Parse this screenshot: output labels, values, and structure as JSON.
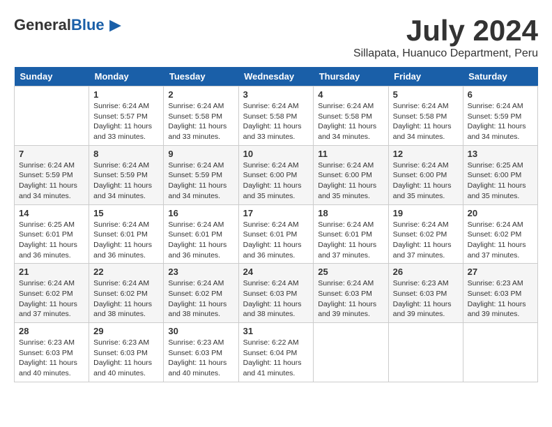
{
  "header": {
    "logo_general": "General",
    "logo_blue": "Blue",
    "month_year": "July 2024",
    "location": "Sillapata, Huanuco Department, Peru"
  },
  "days_of_week": [
    "Sunday",
    "Monday",
    "Tuesday",
    "Wednesday",
    "Thursday",
    "Friday",
    "Saturday"
  ],
  "weeks": [
    [
      {
        "day": "",
        "info": ""
      },
      {
        "day": "1",
        "info": "Sunrise: 6:24 AM\nSunset: 5:57 PM\nDaylight: 11 hours\nand 33 minutes."
      },
      {
        "day": "2",
        "info": "Sunrise: 6:24 AM\nSunset: 5:58 PM\nDaylight: 11 hours\nand 33 minutes."
      },
      {
        "day": "3",
        "info": "Sunrise: 6:24 AM\nSunset: 5:58 PM\nDaylight: 11 hours\nand 33 minutes."
      },
      {
        "day": "4",
        "info": "Sunrise: 6:24 AM\nSunset: 5:58 PM\nDaylight: 11 hours\nand 34 minutes."
      },
      {
        "day": "5",
        "info": "Sunrise: 6:24 AM\nSunset: 5:58 PM\nDaylight: 11 hours\nand 34 minutes."
      },
      {
        "day": "6",
        "info": "Sunrise: 6:24 AM\nSunset: 5:59 PM\nDaylight: 11 hours\nand 34 minutes."
      }
    ],
    [
      {
        "day": "7",
        "info": ""
      },
      {
        "day": "8",
        "info": "Sunrise: 6:24 AM\nSunset: 5:59 PM\nDaylight: 11 hours\nand 34 minutes."
      },
      {
        "day": "9",
        "info": "Sunrise: 6:24 AM\nSunset: 5:59 PM\nDaylight: 11 hours\nand 34 minutes."
      },
      {
        "day": "10",
        "info": "Sunrise: 6:24 AM\nSunset: 6:00 PM\nDaylight: 11 hours\nand 35 minutes."
      },
      {
        "day": "11",
        "info": "Sunrise: 6:24 AM\nSunset: 6:00 PM\nDaylight: 11 hours\nand 35 minutes."
      },
      {
        "day": "12",
        "info": "Sunrise: 6:24 AM\nSunset: 6:00 PM\nDaylight: 11 hours\nand 35 minutes."
      },
      {
        "day": "13",
        "info": "Sunrise: 6:25 AM\nSunset: 6:00 PM\nDaylight: 11 hours\nand 35 minutes."
      }
    ],
    [
      {
        "day": "14",
        "info": ""
      },
      {
        "day": "15",
        "info": "Sunrise: 6:24 AM\nSunset: 6:01 PM\nDaylight: 11 hours\nand 36 minutes."
      },
      {
        "day": "16",
        "info": "Sunrise: 6:24 AM\nSunset: 6:01 PM\nDaylight: 11 hours\nand 36 minutes."
      },
      {
        "day": "17",
        "info": "Sunrise: 6:24 AM\nSunset: 6:01 PM\nDaylight: 11 hours\nand 36 minutes."
      },
      {
        "day": "18",
        "info": "Sunrise: 6:24 AM\nSunset: 6:01 PM\nDaylight: 11 hours\nand 37 minutes."
      },
      {
        "day": "19",
        "info": "Sunrise: 6:24 AM\nSunset: 6:02 PM\nDaylight: 11 hours\nand 37 minutes."
      },
      {
        "day": "20",
        "info": "Sunrise: 6:24 AM\nSunset: 6:02 PM\nDaylight: 11 hours\nand 37 minutes."
      }
    ],
    [
      {
        "day": "21",
        "info": ""
      },
      {
        "day": "22",
        "info": "Sunrise: 6:24 AM\nSunset: 6:02 PM\nDaylight: 11 hours\nand 38 minutes."
      },
      {
        "day": "23",
        "info": "Sunrise: 6:24 AM\nSunset: 6:02 PM\nDaylight: 11 hours\nand 38 minutes."
      },
      {
        "day": "24",
        "info": "Sunrise: 6:24 AM\nSunset: 6:03 PM\nDaylight: 11 hours\nand 38 minutes."
      },
      {
        "day": "25",
        "info": "Sunrise: 6:24 AM\nSunset: 6:03 PM\nDaylight: 11 hours\nand 39 minutes."
      },
      {
        "day": "26",
        "info": "Sunrise: 6:23 AM\nSunset: 6:03 PM\nDaylight: 11 hours\nand 39 minutes."
      },
      {
        "day": "27",
        "info": "Sunrise: 6:23 AM\nSunset: 6:03 PM\nDaylight: 11 hours\nand 39 minutes."
      }
    ],
    [
      {
        "day": "28",
        "info": "Sunrise: 6:23 AM\nSunset: 6:03 PM\nDaylight: 11 hours\nand 40 minutes."
      },
      {
        "day": "29",
        "info": "Sunrise: 6:23 AM\nSunset: 6:03 PM\nDaylight: 11 hours\nand 40 minutes."
      },
      {
        "day": "30",
        "info": "Sunrise: 6:23 AM\nSunset: 6:03 PM\nDaylight: 11 hours\nand 40 minutes."
      },
      {
        "day": "31",
        "info": "Sunrise: 6:22 AM\nSunset: 6:04 PM\nDaylight: 11 hours\nand 41 minutes."
      },
      {
        "day": "",
        "info": ""
      },
      {
        "day": "",
        "info": ""
      },
      {
        "day": "",
        "info": ""
      }
    ]
  ],
  "week7_day14_info": "Sunrise: 6:25 AM\nSunset: 6:01 PM\nDaylight: 11 hours\nand 36 minutes.",
  "week4_day7_info": "Sunrise: 6:24 AM\nSunset: 5:59 PM\nDaylight: 11 hours\nand 34 minutes.",
  "week5_day21_info": "Sunrise: 6:24 AM\nSunset: 6:02 PM\nDaylight: 11 hours\nand 37 minutes."
}
